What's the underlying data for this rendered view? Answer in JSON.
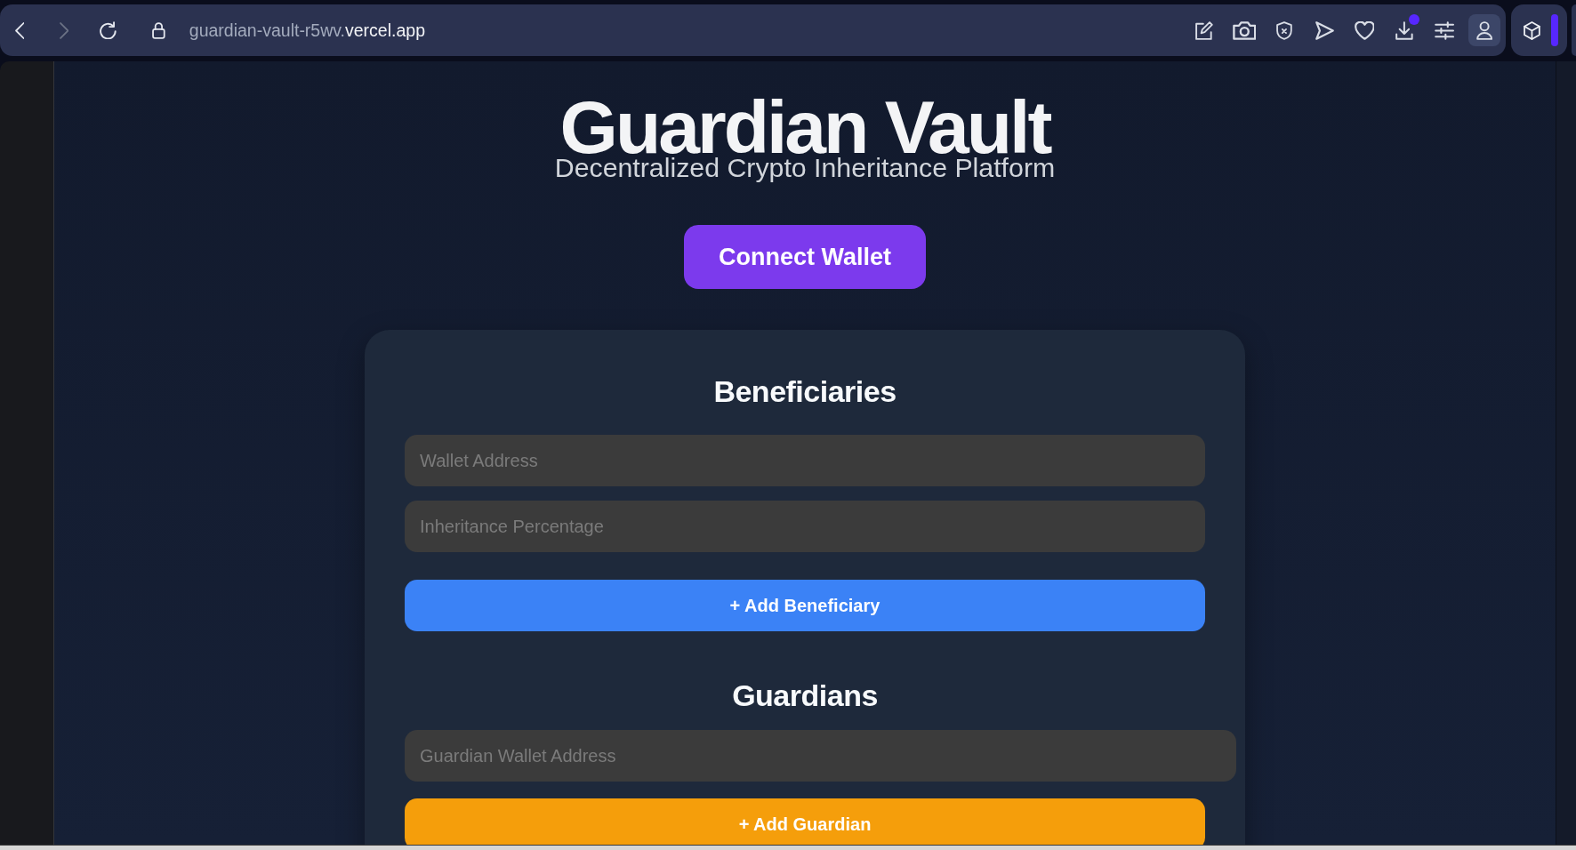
{
  "browser": {
    "nav_buttons": [
      {
        "kind": "back",
        "disabled": false
      },
      {
        "kind": "forward",
        "disabled": true
      },
      {
        "kind": "reload",
        "disabled": false
      }
    ],
    "address": {
      "host_prefix": "guardian-vault-r5wv.",
      "host_domain": "vercel.app"
    },
    "toolbar_icons": [
      {
        "kind": "edit",
        "dot": false,
        "active": false
      },
      {
        "kind": "camera",
        "dot": false,
        "active": false
      },
      {
        "kind": "shield",
        "dot": false,
        "active": false
      },
      {
        "kind": "send",
        "dot": false,
        "active": false
      },
      {
        "kind": "heart",
        "dot": false,
        "active": false
      },
      {
        "kind": "download",
        "dot": true,
        "active": false
      },
      {
        "kind": "sliders",
        "dot": false,
        "active": false
      },
      {
        "kind": "profile",
        "dot": false,
        "active": true
      }
    ]
  },
  "page": {
    "title": "Guardian Vault",
    "subtitle": "Decentralized Crypto Inheritance Platform",
    "connect_button": "Connect Wallet",
    "sections": [
      {
        "heading": "Beneficiaries",
        "fields": [
          {
            "placeholder": "Wallet Address"
          },
          {
            "placeholder": "Inheritance Percentage"
          }
        ],
        "button": {
          "label": "+ Add Beneficiary",
          "color": "#3b82f6"
        }
      },
      {
        "heading": "Guardians",
        "fields": [
          {
            "placeholder": "Guardian Wallet Address"
          }
        ],
        "button": {
          "label": "+ Add Guardian",
          "color": "#f59e0b"
        }
      }
    ]
  }
}
